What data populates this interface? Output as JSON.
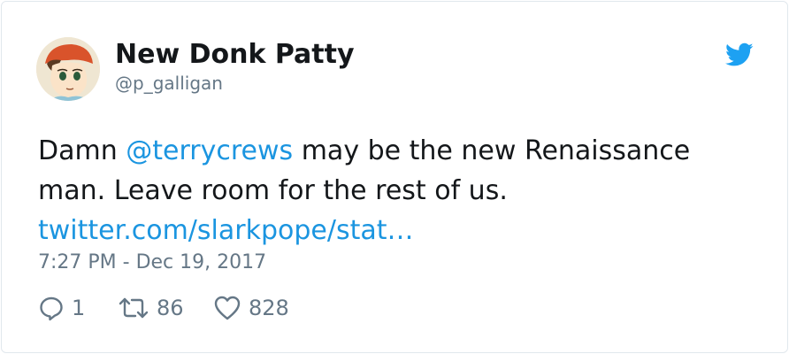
{
  "tweet": {
    "display_name": "New Donk Patty",
    "handle": "@p_galligan",
    "text_pre": "Damn ",
    "mention": "@terrycrews",
    "text_post": " may be the new Renaissance man. Leave room for the rest of us. ",
    "link": "twitter.com/slarkpope/stat…",
    "timestamp": "7:27 PM - Dec 19, 2017"
  },
  "actions": {
    "reply_count": "1",
    "retweet_count": "86",
    "like_count": "828"
  },
  "icons": {
    "brand": "twitter-bird-icon",
    "reply": "reply-icon",
    "retweet": "retweet-icon",
    "like": "heart-icon"
  },
  "colors": {
    "brand": "#1da1f2",
    "link": "#1b95e0",
    "secondary_text": "#657786",
    "primary_text": "#14171a",
    "border": "#e1e8ed"
  }
}
